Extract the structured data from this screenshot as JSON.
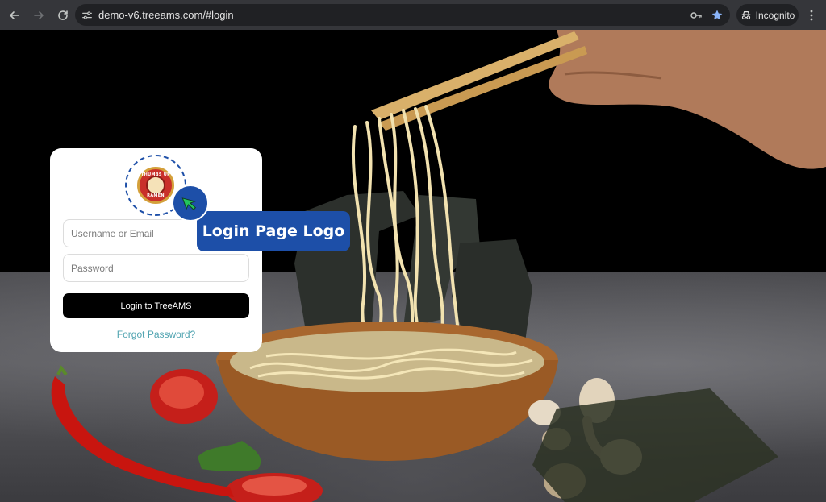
{
  "browser": {
    "url": "demo-v6.treeams.com/#login",
    "mode_label": "Incognito"
  },
  "login": {
    "username_placeholder": "Username or Email",
    "password_placeholder": "Password",
    "login_button": "Login to TreeAMS",
    "forgot_link": "Forgot Password?"
  },
  "logo": {
    "top_text": "THUMBS UP",
    "bottom_text": "RAMEN"
  },
  "annotation": {
    "label": "Login Page Logo"
  },
  "colors": {
    "accent": "#1d4fa8",
    "link": "#4fa3b0",
    "button": "#000000",
    "cursor": "#22c55e"
  }
}
